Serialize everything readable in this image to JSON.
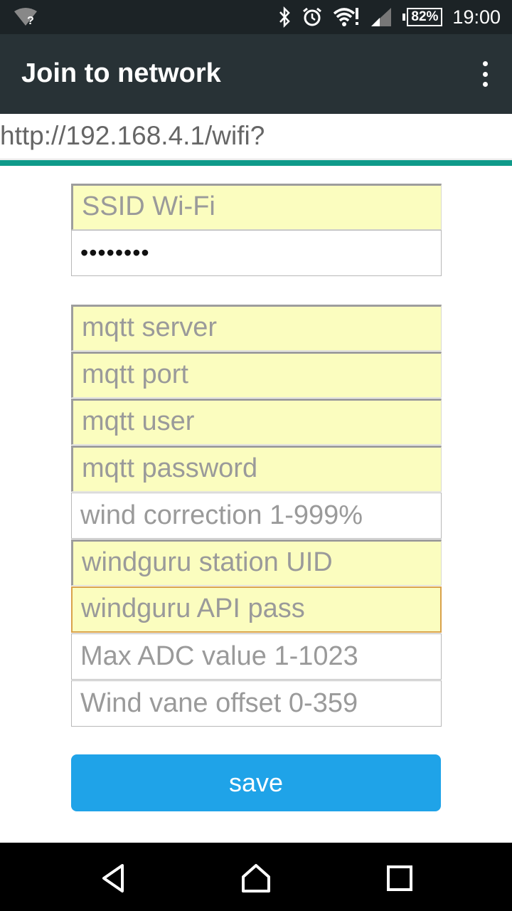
{
  "status_bar": {
    "battery": "82%",
    "time": "19:00",
    "icons": [
      "wifi-unknown-icon",
      "bluetooth-icon",
      "alarm-icon",
      "wifi-alert-icon",
      "signal-icon"
    ]
  },
  "app_bar": {
    "title": "Join to network",
    "menu_icon": "overflow-menu-icon"
  },
  "address": {
    "url": "http://192.168.4.1/wifi?",
    "load_progress": 1.0
  },
  "form": {
    "ssid_placeholder": "SSID Wi-Fi",
    "password_value": "••••••••",
    "mqtt_server_placeholder": "mqtt server",
    "mqtt_port_placeholder": "mqtt port",
    "mqtt_user_placeholder": "mqtt user",
    "mqtt_password_placeholder": "mqtt password",
    "wind_correction_placeholder": "wind correction 1-999%",
    "windguru_uid_placeholder": "windguru station UID",
    "windguru_pass_placeholder": "windguru API pass",
    "max_adc_placeholder": "Max ADC value 1-1023",
    "vane_offset_placeholder": "Wind vane offset 0-359",
    "save_label": "save"
  },
  "colors": {
    "accent": "#1fa3e8",
    "progress": "#0f9a8a",
    "autofill": "#fbfdbf"
  },
  "nav_bar": {
    "icons": [
      "back-icon",
      "home-icon",
      "recents-icon"
    ]
  }
}
